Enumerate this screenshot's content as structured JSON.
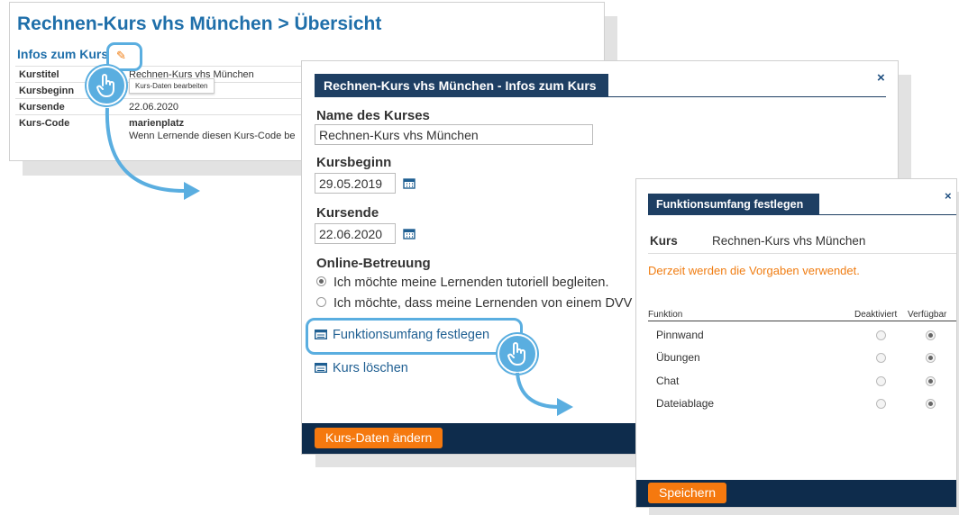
{
  "overview": {
    "title": "Rechnen-Kurs vhs München > Übersicht",
    "section": "Infos zum Kurs",
    "tooltip": "Kurs-Daten bearbeiten",
    "rows": [
      {
        "key": "Kurstitel",
        "value": "Rechnen-Kurs vhs München"
      },
      {
        "key": "Kursbeginn",
        "value": ""
      },
      {
        "key": "Kursende",
        "value": "22.06.2020"
      },
      {
        "key": "Kurs-Code",
        "value": "marienplatz",
        "note": "Wenn Lernende diesen Kurs-Code be"
      }
    ]
  },
  "info_dialog": {
    "title": "Rechnen-Kurs vhs München - Infos zum Kurs",
    "close": "×",
    "name_label": "Name des Kurses",
    "name_value": "Rechnen-Kurs vhs München",
    "start_label": "Kursbeginn",
    "start_value": "29.05.2019",
    "end_label": "Kursende",
    "end_value": "22.06.2020",
    "support_label": "Online-Betreuung",
    "support_options": [
      {
        "label": "Ich möchte meine Lernenden tutoriell begleiten.",
        "selected": true
      },
      {
        "label": "Ich möchte, dass meine Lernenden von einem DVV",
        "selected": false
      }
    ],
    "link_features": "Funktionsumfang festlegen",
    "link_delete": "Kurs löschen",
    "save_button": "Kurs-Daten ändern"
  },
  "features_dialog": {
    "title": "Funktionsumfang festlegen",
    "close": "×",
    "kurs_label": "Kurs",
    "kurs_value": "Rechnen-Kurs vhs München",
    "warning": "Derzeit werden die Vorgaben verwendet.",
    "col_function": "Funktion",
    "col_disabled": "Deaktiviert",
    "col_available": "Verfügbar",
    "functions": [
      {
        "name": "Pinnwand",
        "available": true
      },
      {
        "name": "Übungen",
        "available": true
      },
      {
        "name": "Chat",
        "available": true
      },
      {
        "name": "Dateiablage",
        "available": true
      }
    ],
    "save_button": "Speichern"
  },
  "colors": {
    "accent_blue": "#1f6faa",
    "header_navy": "#1e3f63",
    "footer_navy": "#0e2c4c",
    "orange": "#f5790f",
    "highlight": "#5aaee0"
  }
}
